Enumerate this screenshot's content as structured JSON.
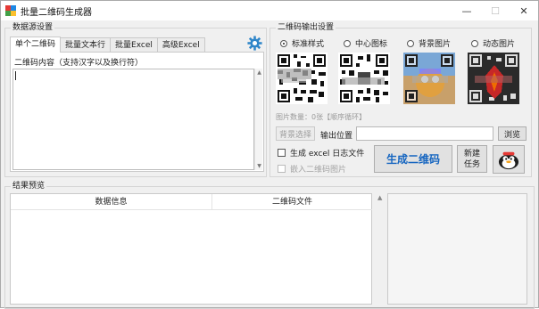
{
  "window": {
    "title": "批量二维码生成器",
    "controls": {
      "minimize": "—",
      "maximize": "☐",
      "close": "✕"
    }
  },
  "data_source": {
    "group_title": "数据源设置",
    "tabs": [
      {
        "label": "单个二维码",
        "active": true
      },
      {
        "label": "批量文本行",
        "active": false
      },
      {
        "label": "批量Excel",
        "active": false
      },
      {
        "label": "高级Excel",
        "active": false
      }
    ],
    "content_label": "二维码内容（支持汉字以及换行符）",
    "content_value": "",
    "settings_icon": "gear-icon"
  },
  "output": {
    "group_title": "二维码输出设置",
    "styles": [
      {
        "label": "标准样式",
        "checked": true
      },
      {
        "label": "中心图标",
        "checked": false
      },
      {
        "label": "背景图片",
        "checked": false
      },
      {
        "label": "动态图片",
        "checked": false
      }
    ],
    "image_count_hint": "图片数量：0张【顺序循环】",
    "bg_select_button": "背景选择",
    "output_location_label": "输出位置",
    "output_location_value": "",
    "browse_button": "浏览",
    "generate_excel_log": "生成 excel 日志文件",
    "embed_qr_image": "嵌入二维码图片",
    "generate_button": "生成二维码",
    "new_task_line1": "新建",
    "new_task_line2": "任务",
    "mascot_icon": "penguin-mascot-icon"
  },
  "results": {
    "group_title": "结果预览",
    "columns": [
      "数据信息",
      "二维码文件"
    ],
    "rows": []
  },
  "colors": {
    "generate_text": "#1565c0",
    "settings_icon": "#2f86c9"
  }
}
